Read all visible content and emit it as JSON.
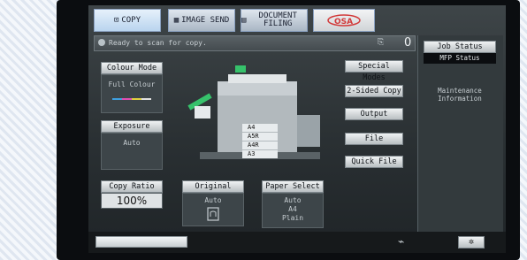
{
  "tabs": [
    {
      "label": "COPY",
      "icon": "copy-icon"
    },
    {
      "label": "IMAGE SEND",
      "icon": "send-icon"
    },
    {
      "label": "DOCUMENT FILING",
      "icon": "filing-icon"
    },
    {
      "label": "",
      "icon": "logo"
    }
  ],
  "message": {
    "text": "Ready to scan for copy.",
    "copy_count": "0"
  },
  "left_controls": {
    "colour_mode": {
      "label": "Colour Mode",
      "value": "Full Colour"
    },
    "exposure": {
      "label": "Exposure",
      "value": "Auto"
    },
    "copy_ratio": {
      "label": "Copy Ratio",
      "value": "100%"
    }
  },
  "original": {
    "label": "Original",
    "value": "Auto"
  },
  "paper_select": {
    "label": "Paper Select",
    "value": "Auto",
    "size": "A4",
    "type": "Plain"
  },
  "trays": [
    "A4",
    "A5R",
    "A4R",
    "A3"
  ],
  "right_buttons": [
    "Special Modes",
    "2-Sided Copy",
    "Output",
    "File",
    "Quick File"
  ],
  "side": {
    "job_status": "Job Status",
    "mfp_status": "MFP Status",
    "maintenance": "Maintenance Information"
  },
  "colors": {
    "screen_bg": "#2a3033",
    "accent_tab": "#cfe3f8",
    "status_green": "#36c26b"
  }
}
